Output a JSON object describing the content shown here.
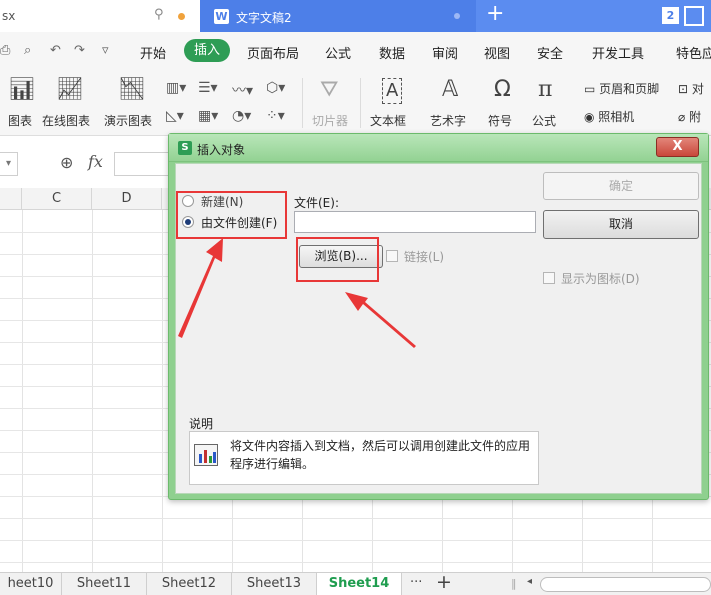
{
  "titlebar": {
    "file_tab_label": "sx",
    "doc_tab_icon": "W",
    "doc_tab_label": "文字文稿2",
    "new_tab_label": "+",
    "window_count": "2"
  },
  "menubar": {
    "items": [
      "开始",
      "插入",
      "页面布局",
      "公式",
      "数据",
      "审阅",
      "视图",
      "安全",
      "开发工具",
      "特色应"
    ],
    "active_item": "插入"
  },
  "ribbon": {
    "buttons": [
      {
        "label": "图表",
        "icon": "bar-chart-icon"
      },
      {
        "label": "在线图表",
        "icon": "online-chart-icon"
      },
      {
        "label": "演示图表",
        "icon": "demo-chart-icon"
      },
      {
        "label": "切片器",
        "icon": "slicer-icon"
      },
      {
        "label": "文本框",
        "icon": "text-box-icon"
      },
      {
        "label": "艺术字",
        "icon": "word-art-icon"
      },
      {
        "label": "符号",
        "icon": "omega-icon"
      },
      {
        "label": "公式",
        "icon": "pi-icon"
      },
      {
        "label": "页眉和页脚",
        "icon": "header-footer-icon"
      },
      {
        "label": "照相机",
        "icon": "camera-icon"
      },
      {
        "label": "对",
        "icon": "object-icon"
      },
      {
        "label": "附",
        "icon": "attachment-icon"
      }
    ]
  },
  "formulabar": {
    "fx_label": "fx"
  },
  "grid": {
    "columns": [
      "C",
      "D"
    ]
  },
  "sheets": {
    "tabs": [
      "heet10",
      "Sheet11",
      "Sheet12",
      "Sheet13",
      "Sheet14"
    ],
    "active": "Sheet14",
    "more_label": "···",
    "add_label": "+"
  },
  "dialog": {
    "title": "插入对象",
    "app_icon": "S",
    "close_label": "X",
    "radio_new_label": "新建(N)",
    "radio_from_file_label": "由文件创建(F)",
    "file_label": "文件(E):",
    "file_value": "",
    "browse_label": "浏览(B)...",
    "link_label": "链接(L)",
    "ok_label": "确定",
    "cancel_label": "取消",
    "display_as_icon_label": "显示为图标(D)",
    "description_title": "说明",
    "description_text": "将文件内容插入到文档，然后可以调用创建此文件的应用程序进行编辑。",
    "selected_option": "由文件创建(F)"
  },
  "colors": {
    "accent_green": "#2e9d55",
    "title_blue": "#5b8cf0",
    "annotation_red": "#e83737",
    "dialog_frame": "#8fd08f"
  }
}
